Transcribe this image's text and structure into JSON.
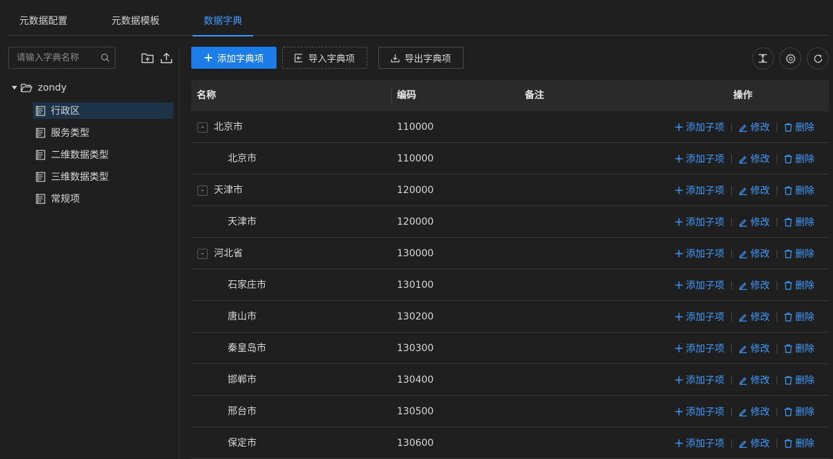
{
  "tabs": [
    {
      "label": "元数据配置",
      "active": false
    },
    {
      "label": "元数据模板",
      "active": false
    },
    {
      "label": "数据字典",
      "active": true
    }
  ],
  "search": {
    "placeholder": "请输入字典名称"
  },
  "tree": {
    "root": "zondy",
    "items": [
      {
        "label": "行政区",
        "selected": true
      },
      {
        "label": "服务类型",
        "selected": false
      },
      {
        "label": "二维数据类型",
        "selected": false
      },
      {
        "label": "三维数据类型",
        "selected": false
      },
      {
        "label": "常规项",
        "selected": false
      }
    ]
  },
  "toolbar": {
    "add_label": "添加字典项",
    "import_label": "导入字典项",
    "export_label": "导出字典项"
  },
  "table": {
    "columns": {
      "name": "名称",
      "code": "编码",
      "remark": "备注",
      "ops": "操作"
    },
    "actions": {
      "add_child": "添加子项",
      "edit": "修改",
      "delete": "删除"
    },
    "expander_symbol": "-",
    "rows": [
      {
        "name": "北京市",
        "code": "110000",
        "level": 0
      },
      {
        "name": "北京市",
        "code": "110000",
        "level": 1
      },
      {
        "name": "天津市",
        "code": "120000",
        "level": 0
      },
      {
        "name": "天津市",
        "code": "120000",
        "level": 1
      },
      {
        "name": "河北省",
        "code": "130000",
        "level": 0
      },
      {
        "name": "石家庄市",
        "code": "130100",
        "level": 1
      },
      {
        "name": "唐山市",
        "code": "130200",
        "level": 1
      },
      {
        "name": "秦皇岛市",
        "code": "130300",
        "level": 1
      },
      {
        "name": "邯郸市",
        "code": "130400",
        "level": 1
      },
      {
        "name": "邢台市",
        "code": "130500",
        "level": 1
      },
      {
        "name": "保定市",
        "code": "130600",
        "level": 1
      }
    ]
  },
  "colors": {
    "accent": "#1c7de8",
    "link": "#3e9bff",
    "background": "#1f1f1f",
    "header": "#2a2a2a",
    "selected": "#1d3347"
  }
}
